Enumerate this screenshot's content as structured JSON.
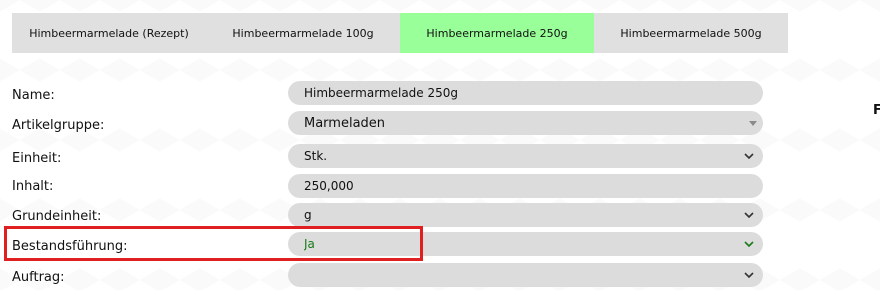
{
  "tabs": [
    {
      "label": "Himbeermarmelade (Rezept)",
      "active": false
    },
    {
      "label": "Himbeermarmelade 100g",
      "active": false
    },
    {
      "label": "Himbeermarmelade 250g",
      "active": true
    },
    {
      "label": "Himbeermarmelade 500g",
      "active": false
    }
  ],
  "form": {
    "name": {
      "label": "Name:",
      "value": "Himbeermarmelade 250g"
    },
    "artikelgruppe": {
      "label": "Artikelgruppe:",
      "value": "Marmeladen",
      "icon": "caret-down-icon"
    },
    "einheit": {
      "label": "Einheit:",
      "value": "Stk.",
      "icon": "chevron-down-icon"
    },
    "inhalt": {
      "label": "Inhalt:",
      "value": "250,000"
    },
    "grundeinheit": {
      "label": "Grundeinheit:",
      "value": "g",
      "icon": "chevron-down-icon"
    },
    "bestandsfuehrung": {
      "label": "Bestandsführung:",
      "value": "Ja",
      "icon": "chevron-down-icon",
      "value_color": "#1a7a1a"
    },
    "auftrag": {
      "label": "Auftrag:",
      "value": "",
      "icon": "chevron-down-icon"
    }
  },
  "edge_text": "F",
  "colors": {
    "active_tab": "#99ff99",
    "tab_bar": "#e0e0e0",
    "field_bg": "#dcdcdc",
    "highlight_border": "#e02020"
  }
}
